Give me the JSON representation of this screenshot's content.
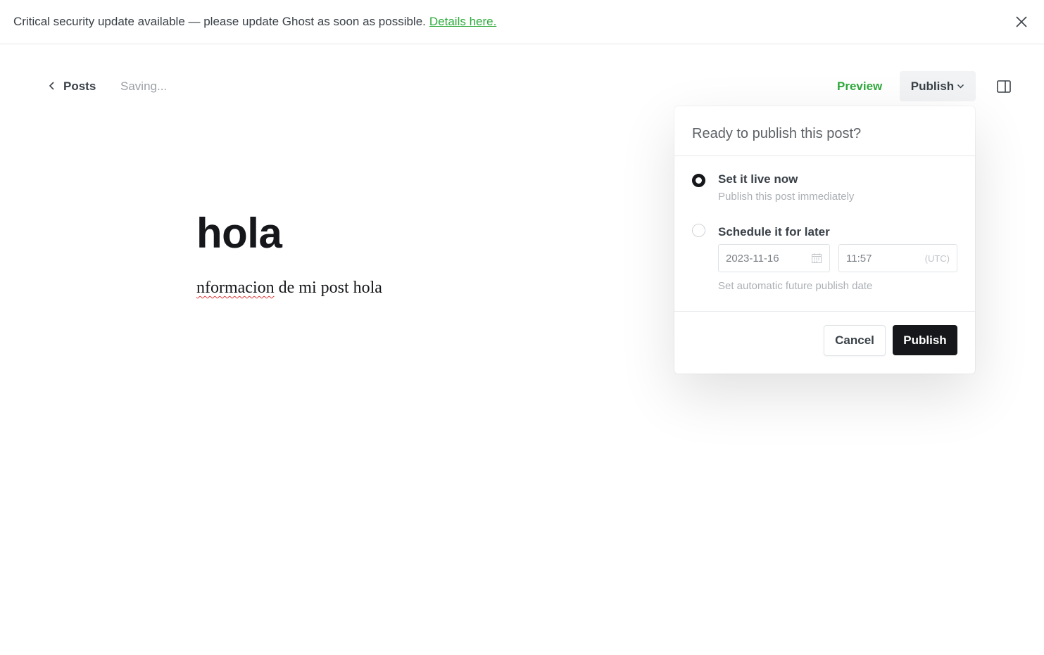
{
  "banner": {
    "message": "Critical security update available — please update Ghost as soon as possible.",
    "link_label": "Details here.",
    "close_icon": "close-icon"
  },
  "topbar": {
    "back_label": "Posts",
    "back_icon": "chevron-left-icon",
    "status": "Saving...",
    "preview_label": "Preview",
    "publish_label": "Publish",
    "publish_icon": "chevron-down-icon",
    "sidebar_icon": "sidebar-toggle-icon"
  },
  "editor": {
    "title": "hola",
    "body_misspelled": "nformacion",
    "body_rest": " de mi post hola"
  },
  "publish_menu": {
    "heading": "Ready to publish this post?",
    "options": [
      {
        "title": "Set it live now",
        "description": "Publish this post immediately",
        "selected": true
      },
      {
        "title": "Schedule it for later",
        "description": "Set automatic future publish date",
        "selected": false
      }
    ],
    "schedule_date": "2023-11-16",
    "schedule_time": "11:57",
    "timezone": "(UTC)",
    "calendar_icon": "calendar-icon",
    "cancel_label": "Cancel",
    "publish_label": "Publish"
  },
  "colors": {
    "accent_green": "#30a93c",
    "dark": "#15171a"
  }
}
